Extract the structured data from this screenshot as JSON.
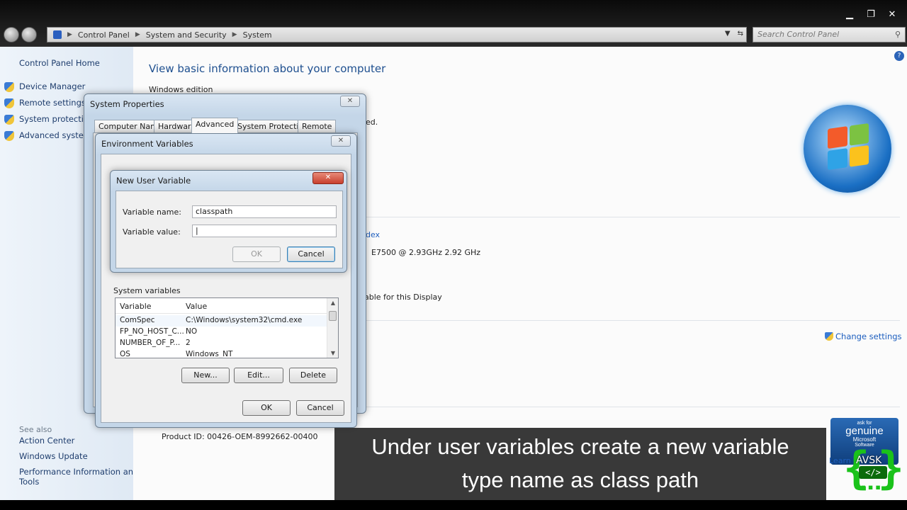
{
  "window": {
    "breadcrumb": [
      "Control Panel",
      "System and Security",
      "System"
    ],
    "search_placeholder": "Search Control Panel",
    "controls": {
      "minimize": "▁",
      "maximize": "❐",
      "close": "✕"
    }
  },
  "sidebar": {
    "home": "Control Panel Home",
    "items": [
      "Device Manager",
      "Remote settings",
      "System protection",
      "Advanced system"
    ],
    "see_also_header": "See also",
    "see_also": [
      "Action Center",
      "Windows Update",
      "Performance Information and",
      "Tools"
    ]
  },
  "content": {
    "title": "View basic information about your computer",
    "windows_edition": "Windows edition",
    "fragment_ed": "ed.",
    "fragment_dex": "dex",
    "processor": "E7500  @ 2.93GHz   2.92 GHz",
    "display": "able for this Display",
    "change_settings": "Change settings",
    "product_id": "Product ID: 00426-OEM-8992662-00400"
  },
  "system_properties": {
    "title": "System Properties",
    "tabs": [
      "Computer Name",
      "Hardware",
      "Advanced",
      "System Protection",
      "Remote"
    ],
    "active_tab": "Advanced"
  },
  "environment_variables": {
    "title": "Environment Variables",
    "system_vars_label": "System variables",
    "columns": [
      "Variable",
      "Value"
    ],
    "rows": [
      {
        "variable": "ComSpec",
        "value": "C:\\Windows\\system32\\cmd.exe"
      },
      {
        "variable": "FP_NO_HOST_C...",
        "value": "NO"
      },
      {
        "variable": "NUMBER_OF_P...",
        "value": "2"
      },
      {
        "variable": "OS",
        "value": "Windows_NT"
      }
    ],
    "new_button": "New...",
    "edit_button": "Edit...",
    "delete_button": "Delete",
    "ok_button": "OK",
    "cancel_button": "Cancel"
  },
  "new_user_variable": {
    "title": "New User Variable",
    "name_label": "Variable name:",
    "name_value": "classpath",
    "value_label": "Variable value:",
    "value_value": "|",
    "ok_button": "OK",
    "cancel_button": "Cancel"
  },
  "caption": {
    "line1": "Under user variables create a new variable",
    "line2": "type name as class path"
  },
  "genuine_badge": {
    "line1": "ask for",
    "line2": "genuine",
    "line3": "Microsoft",
    "line4": "Software",
    "learn_more": "Learn m"
  },
  "watermark": {
    "label": "AVSK",
    "tag": "</>"
  },
  "colors": {
    "link": "#1e5fbf",
    "sidebar_bg": "#e6eef7",
    "close_red": "#c8402e",
    "caption_bg": "#282828",
    "watermark": "#1ac21a"
  }
}
